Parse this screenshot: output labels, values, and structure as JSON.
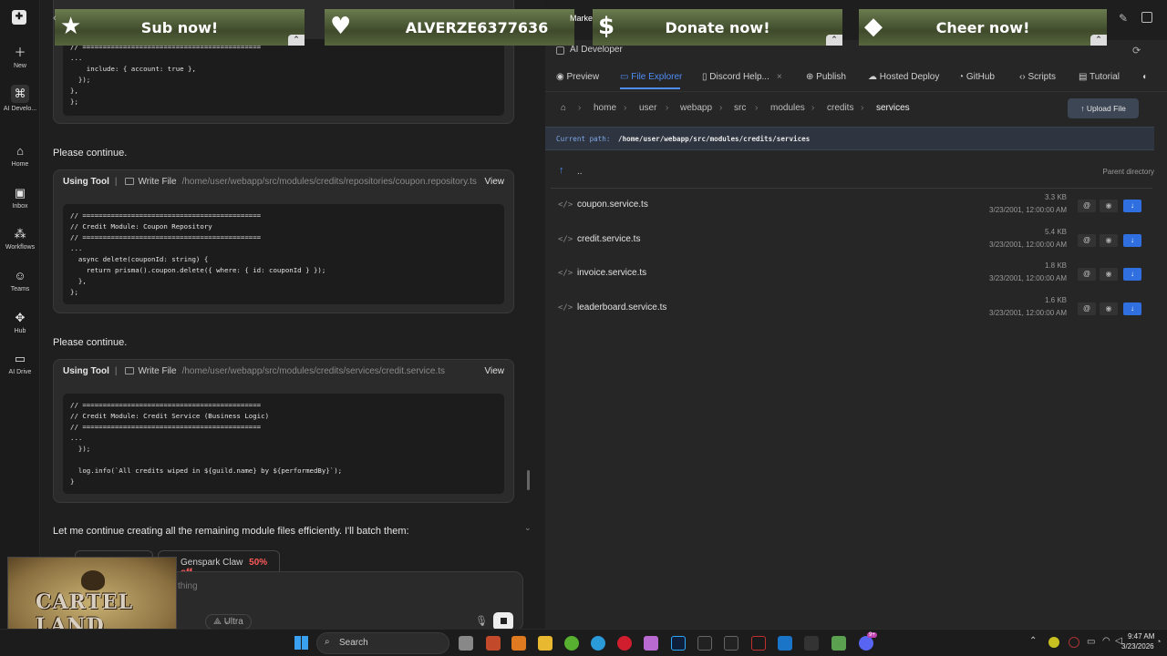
{
  "sidebar": {
    "items": [
      {
        "label": "New",
        "icon": "plus-icon"
      },
      {
        "label": "AI Develo...",
        "icon": "ai-developer-icon"
      },
      {
        "label": "Home",
        "icon": "home-icon"
      },
      {
        "label": "Inbox",
        "icon": "inbox-icon"
      },
      {
        "label": "Workflows",
        "icon": "workflows-icon"
      },
      {
        "label": "Teams",
        "icon": "teams-icon"
      },
      {
        "label": "Hub",
        "icon": "hub-icon"
      },
      {
        "label": "AI Drive",
        "icon": "folder-icon"
      }
    ]
  },
  "overlay": {
    "items": [
      {
        "label": "Sub now!",
        "icon": "star-icon"
      },
      {
        "label": "ALVERZE6377636",
        "icon": "heart-icon"
      },
      {
        "label": "Donate now!",
        "icon": "dollar-icon"
      },
      {
        "label": "Cheer now!",
        "icon": "diamond-icon"
      }
    ],
    "marker": "Marke"
  },
  "chat": {
    "code1": "// ============================================\n...\n    include: { account: true },\n  });\n},\n};",
    "continue1": "Please continue.",
    "tool2": {
      "label": "Using Tool",
      "sep": "|",
      "action": "Write File",
      "path": "/home/user/webapp/src/modules/credits/repositories/coupon.repository.ts",
      "view": "View"
    },
    "code2": "// ============================================\n// Credit Module: Coupon Repository\n// ============================================\n...\n  async delete(couponId: string) {\n    return prisma().coupon.delete({ where: { id: couponId } });\n  },\n};",
    "continue2": "Please continue.",
    "tool3": {
      "label": "Using Tool",
      "sep": "|",
      "action": "Write File",
      "path": "/home/user/webapp/src/modules/credits/services/credit.service.ts",
      "view": "View"
    },
    "code3": "// ============================================\n// Credit Module: Credit Service (Business Logic)\n// ============================================\n...\n  });\n\n  log.info(`All credits wiped in ${guild.name} by ${performedBy}`);\n}",
    "continue_text": "Let me continue creating all the remaining module files efficiently. I'll batch them:",
    "promo": {
      "name": "Genspark Claw",
      "discount": "50% off"
    },
    "input_placeholder": "thing",
    "mode": "Ultra"
  },
  "panel": {
    "title": "AI Developer",
    "tabs": [
      "Preview",
      "File Explorer",
      "Discord Help...",
      "Publish",
      "Hosted Deploy",
      "GitHub",
      "Scripts",
      "Tutorial"
    ],
    "breadcrumb": [
      "home",
      "user",
      "webapp",
      "src",
      "modules",
      "credits",
      "services"
    ],
    "upload_label": "Upload File",
    "current_path_label": "Current path:",
    "current_path": "/home/user/webapp/src/modules/credits/services",
    "parent_label": "..",
    "parent_hint": "Parent directory",
    "files": [
      {
        "name": "coupon.service.ts",
        "size": "3.3 KB",
        "date": "3/23/2001, 12:00:00 AM"
      },
      {
        "name": "credit.service.ts",
        "size": "5.4 KB",
        "date": "3/23/2001, 12:00:00 AM"
      },
      {
        "name": "invoice.service.ts",
        "size": "1.8 KB",
        "date": "3/23/2001, 12:00:00 AM"
      },
      {
        "name": "leaderboard.service.ts",
        "size": "1.6 KB",
        "date": "3/23/2001, 12:00:00 AM"
      }
    ]
  },
  "taskbar": {
    "search_label": "Search",
    "time": "9:47 AM",
    "date": "3/23/2026",
    "notification_count": "9+"
  },
  "webcam": {
    "title": "CARTEL LAND"
  },
  "colors": {
    "accent": "#4f8df5",
    "download": "#2f6fe0",
    "promo_red": "#ff5a5a"
  }
}
